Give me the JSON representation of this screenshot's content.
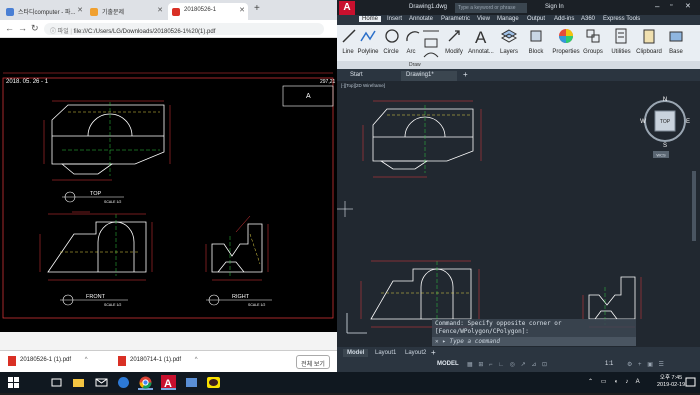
{
  "browser": {
    "tabs": [
      {
        "label": "스타디computer - 파..."
      },
      {
        "label": "기출문제"
      },
      {
        "label": "20180526-1"
      }
    ],
    "address_prefix": "파일",
    "url": "file:///C:/Users/LG/Downloads/20180526-1%20(1).pdf"
  },
  "pdf": {
    "date": "2018. 05. 26 - 1",
    "page_corner": "297,21",
    "title_block": "A",
    "top_label": "TOP",
    "top_scale": "SCALE 1/2",
    "front_label": "FRONT",
    "front_scale": "SCALE 1/2",
    "right_label": "RIGHT",
    "right_scale": "SCALE 1/2"
  },
  "downloads": {
    "items": [
      {
        "label": "20180526-1 (1).pdf"
      },
      {
        "label": "20180714-1 (1).pdf"
      }
    ],
    "show_all": "전체 보기"
  },
  "autocad": {
    "file_title": "Drawing1.dwg",
    "search_placeholder": "Type a keyword or phrase",
    "sign_in": "Sign In",
    "ribbon_tabs": [
      "Home",
      "Insert",
      "Annotate",
      "Parametric",
      "View",
      "Manage",
      "Output",
      "Add-ins",
      "A360",
      "Express Tools"
    ],
    "ribbon_buttons": [
      "Line",
      "Polyline",
      "Circle",
      "Arc",
      "Modify",
      "Annotat...",
      "Layers",
      "Block",
      "Properties",
      "Groups",
      "Utilities",
      "Clipboard",
      "Base"
    ],
    "draw_panel": "Draw",
    "file_tabs": [
      "Start",
      "Drawing1*"
    ],
    "viewport_label": "[-][Top][2D Wireframe]",
    "viewcube": {
      "n": "N",
      "s": "S",
      "e": "E",
      "w": "W",
      "top": "TOP",
      "wcs": "WCS"
    },
    "command_history": "Command: Specify opposite corner or [Fence/WPolygon/CPolygon]:",
    "command_placeholder": "Type a command",
    "layout_tabs": [
      "Model",
      "Layout1",
      "Layout2"
    ],
    "status_model": "MODEL",
    "scale": "1:1"
  },
  "taskbar": {
    "time": "오후 7:45",
    "date": "2019-02-19"
  },
  "colors": {
    "cad_bg": "#212830",
    "line_white": "#ffffff",
    "dim_red": "#e8383d",
    "center_green": "#2ecc40",
    "hidden_yellow": "#e8d84a"
  }
}
